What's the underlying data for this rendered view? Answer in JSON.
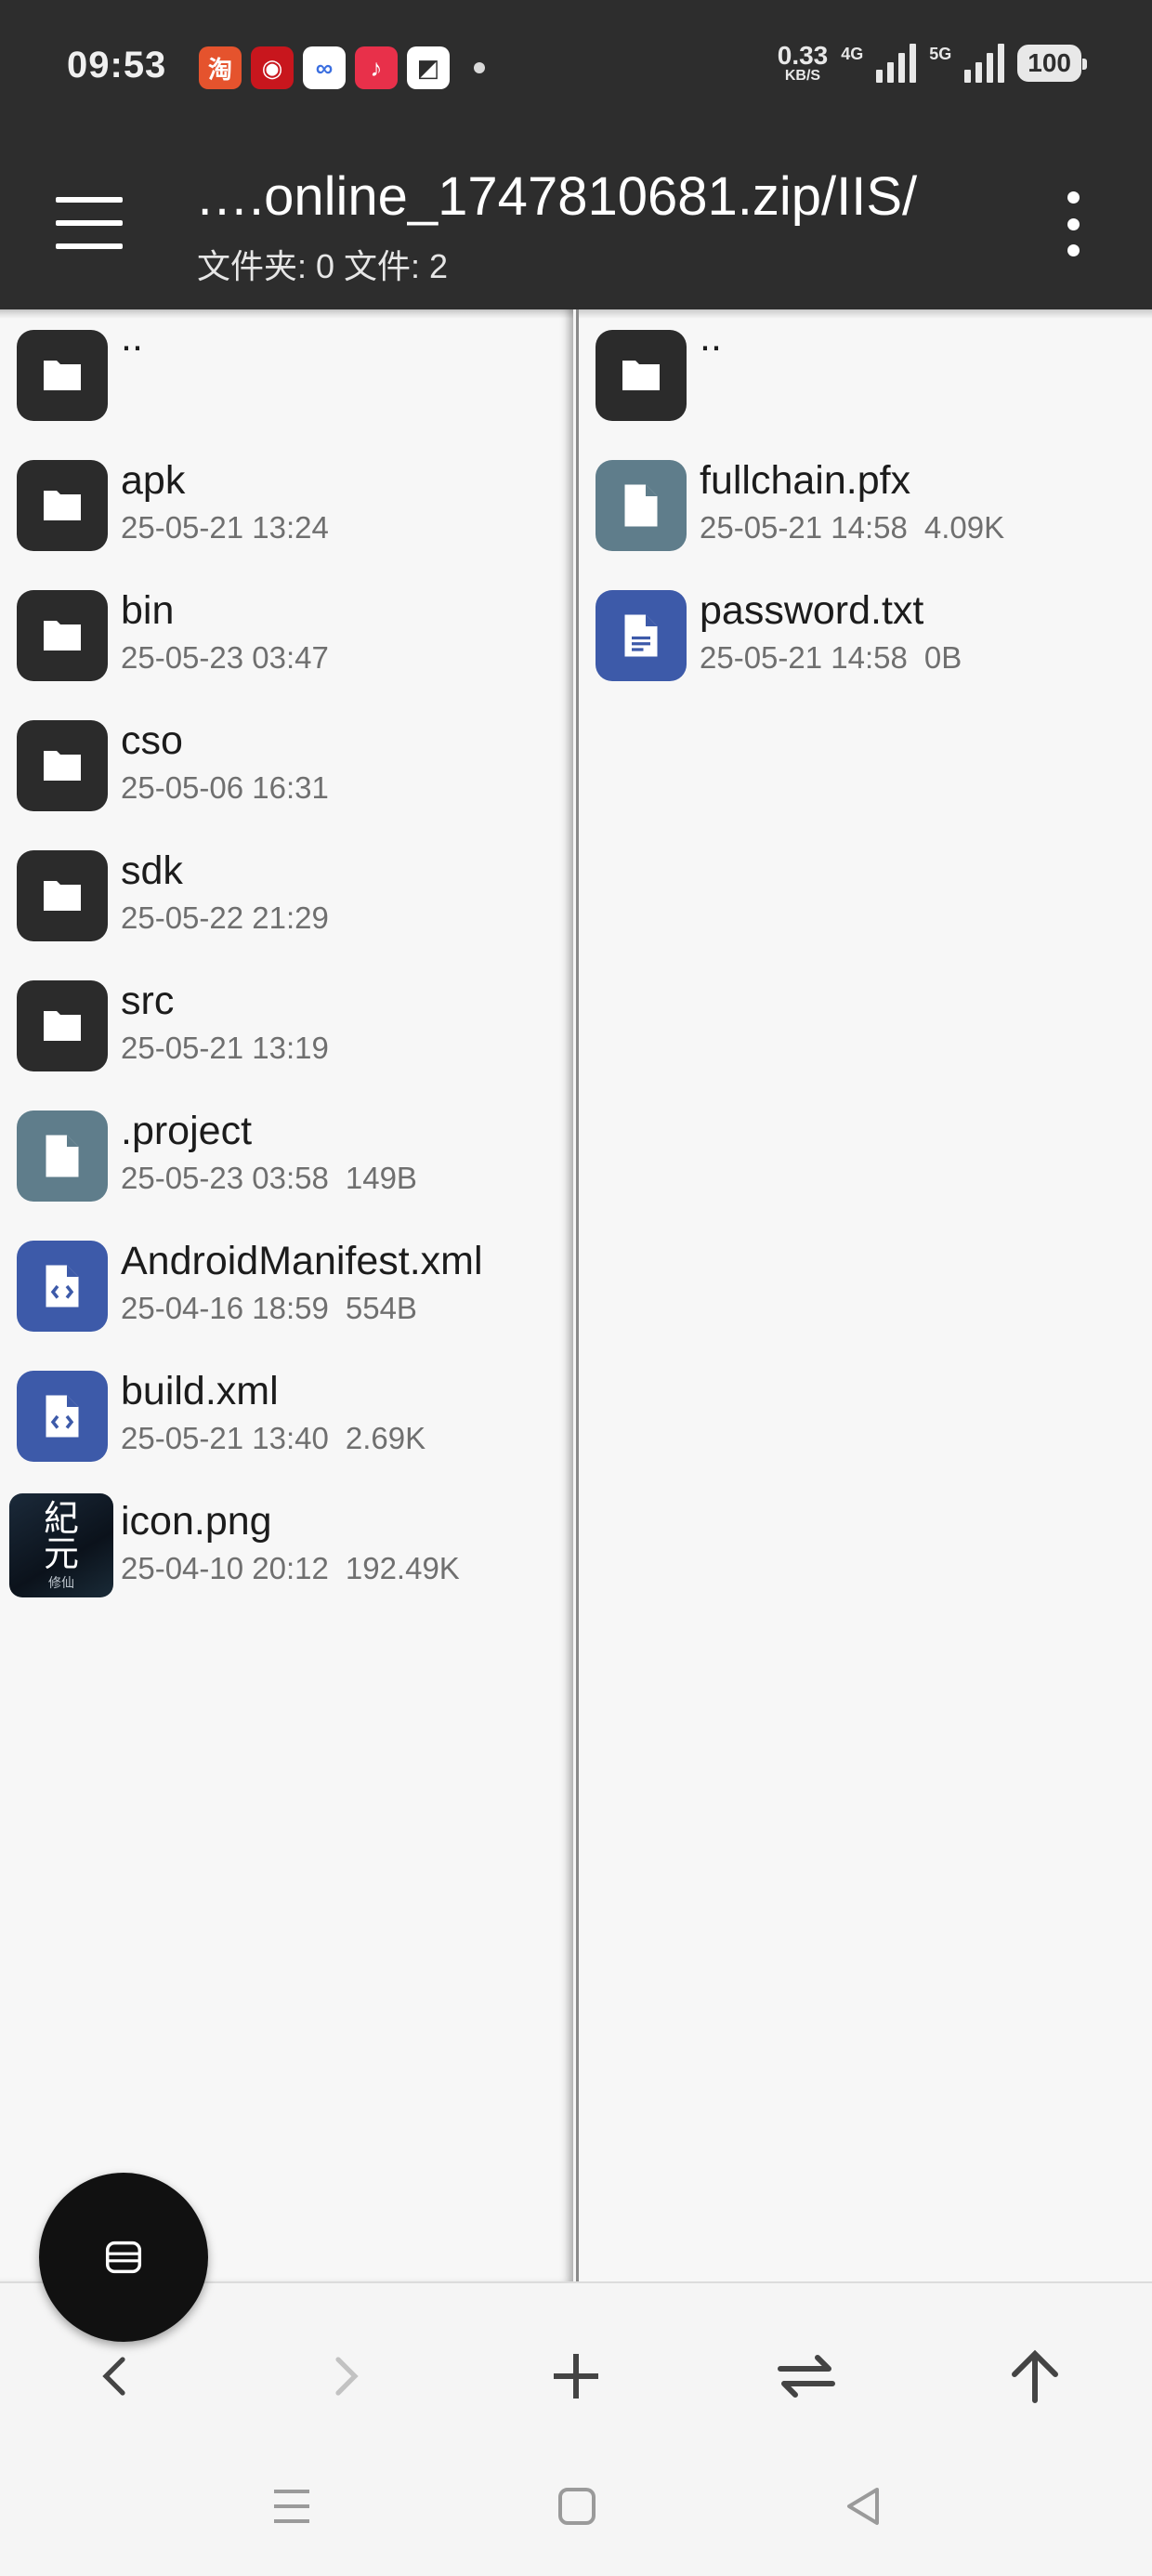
{
  "status_bar": {
    "time": "09:53",
    "app_icons": [
      {
        "name": "taobao-icon",
        "label": "淘",
        "color": "#e5532d"
      },
      {
        "name": "bank-icon",
        "label": "◉",
        "color": "#c8161d"
      },
      {
        "name": "cloud-icon",
        "label": "∞",
        "color": "#ffffff"
      },
      {
        "name": "music-icon",
        "label": "♪",
        "color": "#e8304a"
      },
      {
        "name": "tool-icon",
        "label": "◩",
        "color": "#ffffff"
      }
    ],
    "net_speed_value": "0.33",
    "net_speed_unit": "KB/S",
    "sim1_type": "4G",
    "sim2_type": "5G",
    "battery": "100"
  },
  "toolbar": {
    "title": "….online_1747810681.zip/IIS/",
    "subtitle": "文件夹: 0  文件: 2"
  },
  "left_pane": {
    "items": [
      {
        "name": "..",
        "date": "",
        "size": "",
        "type": "folder"
      },
      {
        "name": "apk",
        "date": "25-05-21 13:24",
        "size": "",
        "type": "folder"
      },
      {
        "name": "bin",
        "date": "25-05-23 03:47",
        "size": "",
        "type": "folder"
      },
      {
        "name": "cso",
        "date": "25-05-06 16:31",
        "size": "",
        "type": "folder"
      },
      {
        "name": "sdk",
        "date": "25-05-22 21:29",
        "size": "",
        "type": "folder"
      },
      {
        "name": "src",
        "date": "25-05-21 13:19",
        "size": "",
        "type": "folder"
      },
      {
        "name": ".project",
        "date": "25-05-23 03:58",
        "size": "149B",
        "type": "file"
      },
      {
        "name": "AndroidManifest.xml",
        "date": "25-04-16 18:59",
        "size": "554B",
        "type": "code"
      },
      {
        "name": "build.xml",
        "date": "25-05-21 13:40",
        "size": "2.69K",
        "type": "code"
      },
      {
        "name": "icon.png",
        "date": "25-04-10 20:12",
        "size": "192.49K",
        "type": "image",
        "thumb_text": [
          "紀",
          "元"
        ],
        "thumb_caption": "修仙"
      }
    ]
  },
  "right_pane": {
    "items": [
      {
        "name": "..",
        "date": "",
        "size": "",
        "type": "folder"
      },
      {
        "name": "fullchain.pfx",
        "date": "25-05-21 14:58",
        "size": "4.09K",
        "type": "file"
      },
      {
        "name": "password.txt",
        "date": "25-05-21 14:58",
        "size": "0B",
        "type": "text"
      }
    ]
  },
  "colors": {
    "toolbar_bg": "#2d2d2d",
    "folder_icon_bg": "#2b2b2b",
    "file_icon_bg": "#5f7d8b",
    "doc_icon_bg": "#3d5aa9"
  }
}
